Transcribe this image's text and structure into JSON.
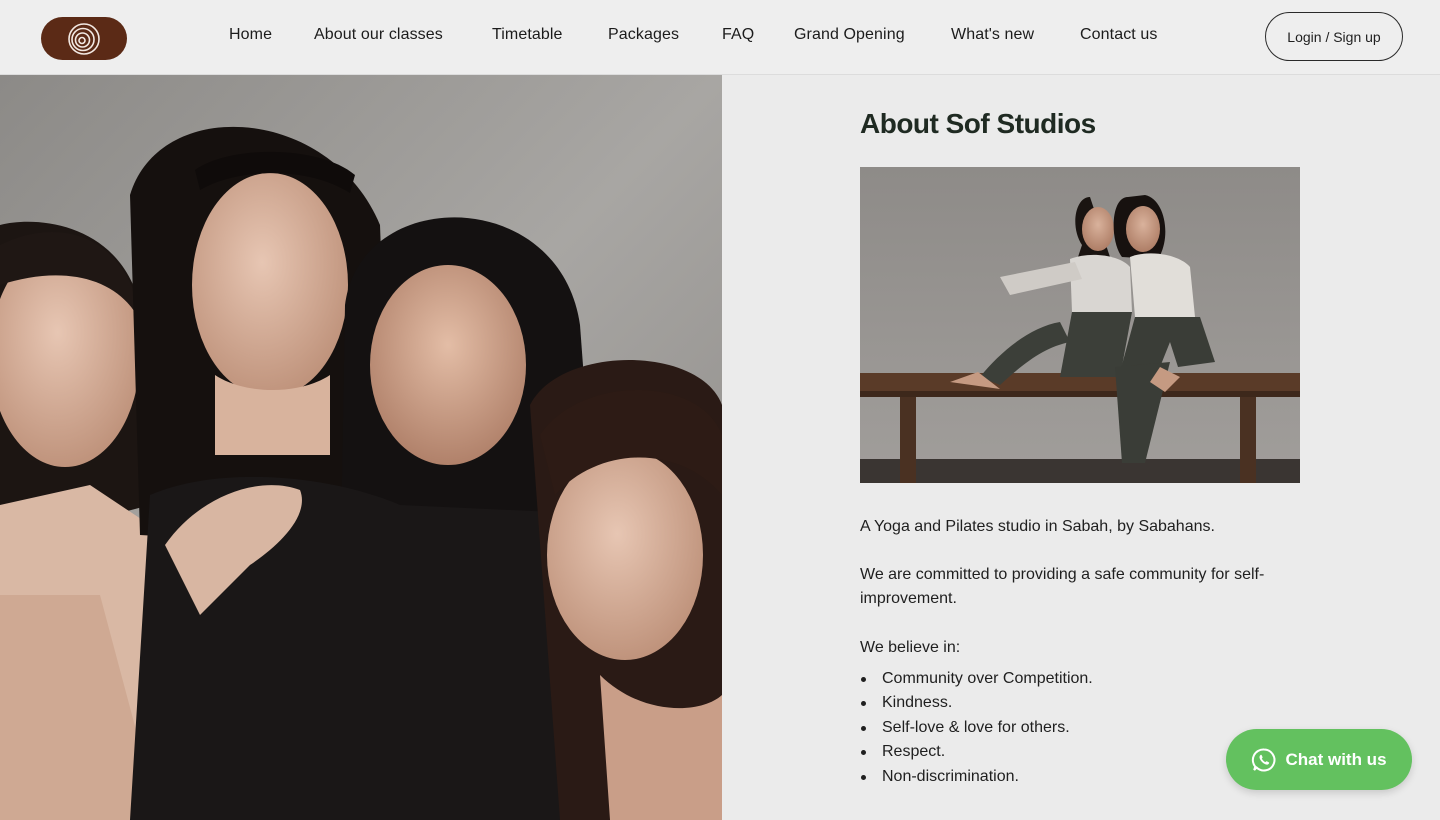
{
  "header": {
    "logo_name": "spiral-logo-icon",
    "nav": [
      {
        "label": "Home"
      },
      {
        "label": "About our classes"
      },
      {
        "label": "Timetable"
      },
      {
        "label": "Packages"
      },
      {
        "label": "FAQ"
      },
      {
        "label": "Grand Opening"
      },
      {
        "label": "What's new"
      },
      {
        "label": "Contact us"
      }
    ],
    "login_label": "Login / Sign up"
  },
  "about": {
    "title": "About Sof Studios",
    "intro": "A Yoga and Pilates studio in Sabah, by Sabahans.",
    "commitment": "We are committed to providing a safe community for self-improvement.",
    "believe_heading": "We believe in:",
    "values": [
      "Community over Competition.",
      "Kindness.",
      "Self-love & love for others.",
      "Respect.",
      "Non-discrimination."
    ]
  },
  "chat": {
    "label": "Chat with us",
    "icon": "whatsapp-icon"
  },
  "colors": {
    "logo_bg": "#5b2a16",
    "chat_bg": "#63c15f",
    "page_bg": "#ebebeb",
    "header_bg": "#eeeeee"
  }
}
